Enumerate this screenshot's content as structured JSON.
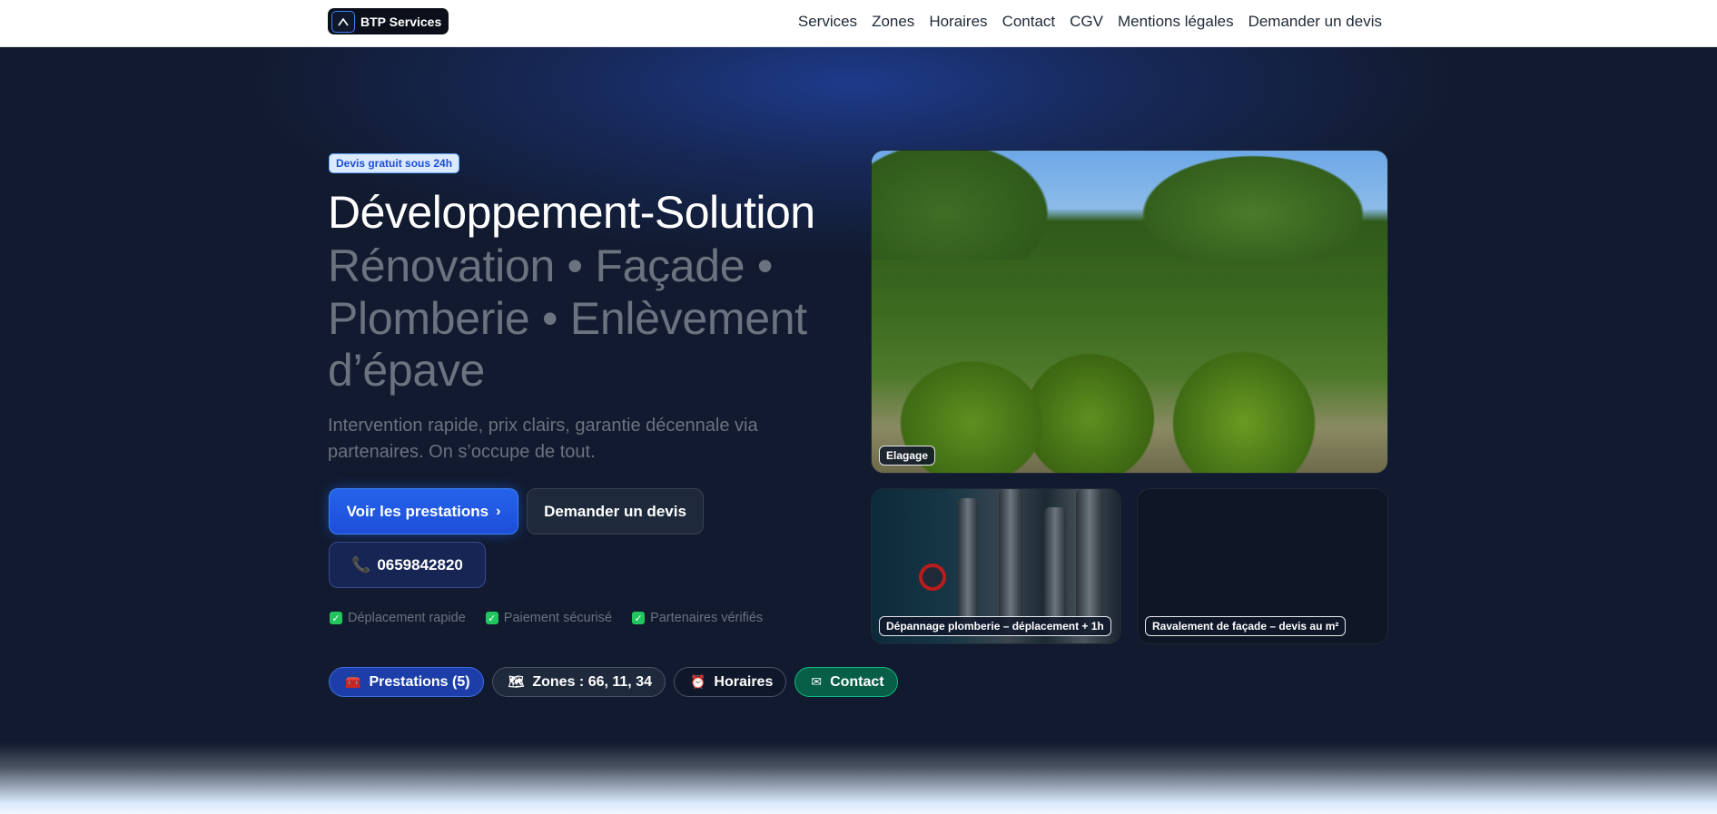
{
  "header": {
    "brand": "BTP Services",
    "nav": [
      "Services",
      "Zones",
      "Horaires",
      "Contact",
      "CGV",
      "Mentions légales",
      "Demander un devis"
    ]
  },
  "hero": {
    "badge": "Devis gratuit sous 24h",
    "title": "Développement-Solution",
    "subtitle_line1": "Rénovation • Façade •",
    "subtitle_line2": "Plomberie • Enlèvement",
    "subtitle_line3": "d’épave",
    "lead": "Intervention rapide, prix clairs, garantie décennale via partenaires. On s’occupe de tout.",
    "primary_cta": "Voir les prestations",
    "secondary_cta": "Demander un devis",
    "phone": "0659842820",
    "checks": [
      "Déplacement rapide",
      "Paiement sécurisé",
      "Partenaires vérifiés"
    ],
    "chips": [
      {
        "label": "Prestations (5)",
        "icon": "toolbox-icon"
      },
      {
        "label": "Zones : 66, 11, 34",
        "icon": "map-icon"
      },
      {
        "label": "Horaires",
        "icon": "alarm-clock-icon"
      },
      {
        "label": "Contact",
        "icon": "envelope-icon"
      }
    ]
  },
  "gallery": {
    "main_caption": "Elagage",
    "plumbing_caption": "Dépannage plomberie – déplacement + 1h",
    "facade_caption": "Ravalement de façade – devis au m²"
  },
  "colors": {
    "primary": "#2563eb",
    "background": "#111a2e",
    "accent_green": "#065f46",
    "phone_icon": "#ec4899"
  }
}
